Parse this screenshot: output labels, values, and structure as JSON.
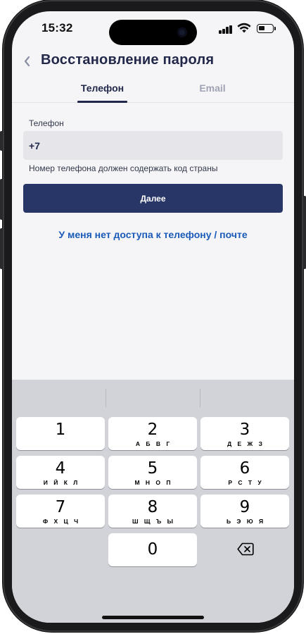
{
  "status_bar": {
    "time": "15:32",
    "icons": [
      "signal-icon",
      "wifi-icon",
      "battery-icon"
    ]
  },
  "header": {
    "back_icon": "chevron-left-icon",
    "title": "Восстановление пароля"
  },
  "tabs": [
    {
      "label": "Телефон",
      "active": true
    },
    {
      "label": "Email",
      "active": false
    }
  ],
  "form": {
    "phone_label": "Телефон",
    "phone_value": "+7",
    "hint": "Номер телефона должен содержать код страны",
    "next_label": "Далее",
    "no_access_link": "У меня нет доступа к телефону / почте"
  },
  "keyboard": {
    "keys": [
      {
        "digit": "1",
        "letters": ""
      },
      {
        "digit": "2",
        "letters": "А Б В Г"
      },
      {
        "digit": "3",
        "letters": "Д Е Ж З"
      },
      {
        "digit": "4",
        "letters": "И Й К Л"
      },
      {
        "digit": "5",
        "letters": "М Н О П"
      },
      {
        "digit": "6",
        "letters": "Р С Т У"
      },
      {
        "digit": "7",
        "letters": "Ф Х Ц Ч"
      },
      {
        "digit": "8",
        "letters": "Ш Щ Ъ Ы"
      },
      {
        "digit": "9",
        "letters": "Ь Э Ю Я"
      },
      {
        "digit": "0",
        "letters": ""
      }
    ],
    "delete_icon": "backspace-icon"
  },
  "colors": {
    "primary": "#283667",
    "title": "#22284a",
    "link": "#1a5ab8",
    "inactive_tab": "#9fa3b4",
    "input_bg": "#e6e6ea",
    "keyboard_bg": "#d1d3d9"
  }
}
